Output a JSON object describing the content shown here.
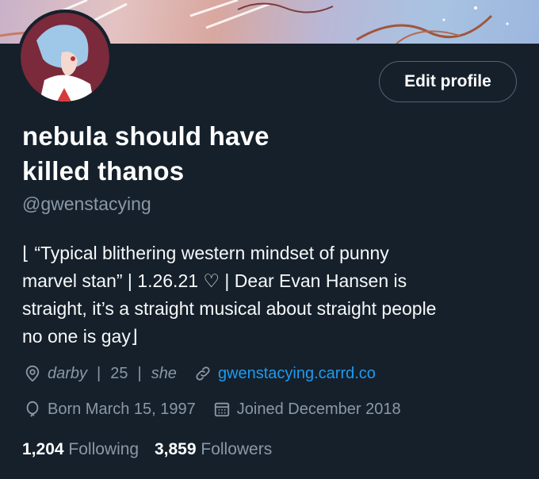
{
  "profile": {
    "display_name_line1": "nebula should have",
    "display_name_line2": "killed thanos",
    "handle": "@gwenstacying",
    "bio_line1": "⌊ “Typical blithering western mindset of punny",
    "bio_line2": "marvel stan” | 1.26.21 ♡ | Dear Evan Hansen is",
    "bio_line3": "straight, it’s a straight musical about straight people",
    "bio_line4": "no one is gay⌋"
  },
  "buttons": {
    "edit_profile": "Edit profile"
  },
  "meta": {
    "location": "darby",
    "age": "25",
    "pronoun": "she",
    "separator": "|",
    "website": "gwenstacying.carrd.co",
    "birth": "Born March 15, 1997",
    "joined": "Joined December 2018"
  },
  "stats": {
    "following_count": "1,204",
    "following_label": "Following",
    "followers_count": "3,859",
    "followers_label": "Followers"
  },
  "colors": {
    "background": "#15202b",
    "secondary_text": "#8b98a5",
    "link": "#1d9bf0"
  },
  "icons": {
    "location": "location-pin-icon",
    "link": "link-chain-icon",
    "birth": "balloon-icon",
    "joined": "calendar-icon"
  }
}
